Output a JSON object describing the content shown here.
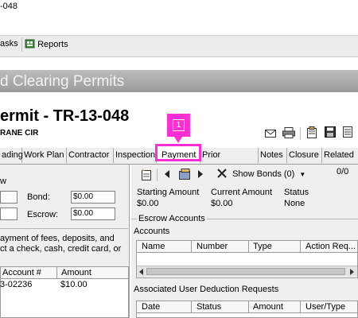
{
  "window": {
    "title_fragment": "-048"
  },
  "toolbar": {
    "tasks_label": "asks",
    "reports_label": "Reports"
  },
  "banner": {
    "title": "d Clearing Permits"
  },
  "permit": {
    "title": "ermit - TR-13-048",
    "address": "RANE CIR"
  },
  "tabs": [
    {
      "label": "ading"
    },
    {
      "label": "Work Plan"
    },
    {
      "label": "Contractor"
    },
    {
      "label": "Inspection"
    },
    {
      "label": "Payment"
    },
    {
      "label": "Prior Approval"
    },
    {
      "label": "Notes"
    },
    {
      "label": "Closure"
    },
    {
      "label": "Related"
    }
  ],
  "marker": {
    "label": "1"
  },
  "left": {
    "row1_label": "w",
    "bond_label": "Bond:",
    "bond_value": "$0.00",
    "escrow_label": "Escrow:",
    "escrow_value": "$0.00",
    "instruction_line1": "ayment of fees, deposits, and",
    "instruction_line2": "ct a check, cash, credit card, or",
    "grid_header_account": "Account #",
    "grid_header_amount": "Amount",
    "row_account": "3-02236",
    "row_amount": "$10.00"
  },
  "payment": {
    "show_bonds_label": "Show Bonds (0)",
    "counter": "0/0",
    "starting_amount_label": "Starting Amount",
    "starting_amount_value": "$0.00",
    "current_amount_label": "Current Amount",
    "current_amount_value": "$0.00",
    "status_label": "Status",
    "status_value": "None",
    "escrow_accounts_label": "Escrow Accounts",
    "accounts_label": "Accounts",
    "accounts_columns": [
      "Name",
      "Number",
      "Type",
      "Action Req..."
    ],
    "deduction_label": "Associated User Deduction Requests",
    "deduction_columns": [
      "Date",
      "Status",
      "Amount",
      "User/Type"
    ]
  },
  "colors": {
    "highlight": "#ff2fd3",
    "banner": "#a8a8a8"
  }
}
